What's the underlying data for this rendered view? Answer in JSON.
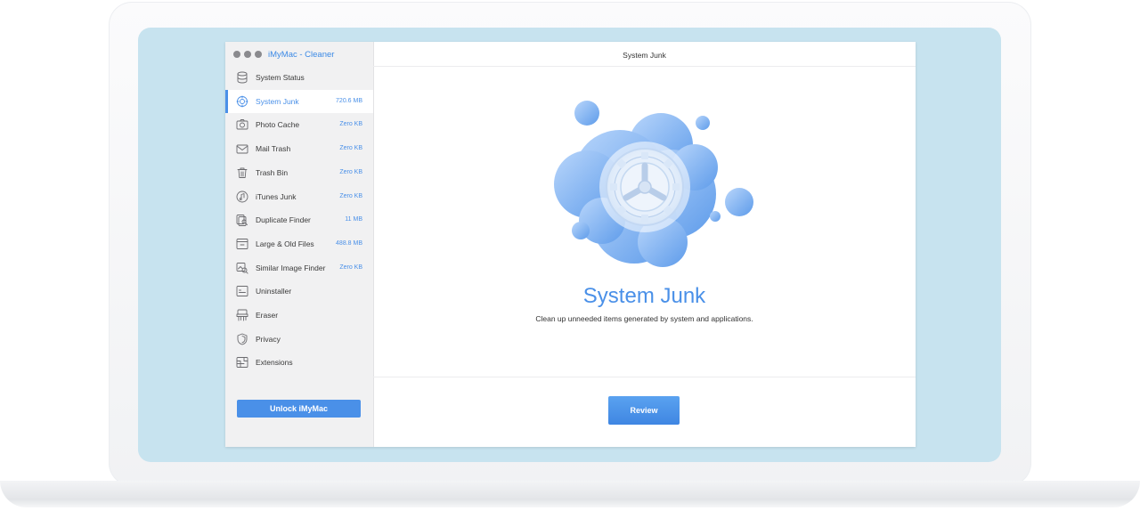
{
  "app": {
    "title": "iMyMac - Cleaner",
    "colors": {
      "accent": "#4a90e8",
      "bezel": "#c7e3ef",
      "sidebar_bg": "#f1f1f2"
    }
  },
  "sidebar": {
    "items": [
      {
        "label": "System Status",
        "size": "",
        "icon": "database-icon",
        "active": false
      },
      {
        "label": "System Junk",
        "size": "720.6 MB",
        "icon": "gear-icon",
        "active": true
      },
      {
        "label": "Photo Cache",
        "size": "Zero KB",
        "icon": "camera-icon",
        "active": false
      },
      {
        "label": "Mail Trash",
        "size": "Zero KB",
        "icon": "mail-icon",
        "active": false
      },
      {
        "label": "Trash Bin",
        "size": "Zero KB",
        "icon": "trash-icon",
        "active": false
      },
      {
        "label": "iTunes Junk",
        "size": "Zero KB",
        "icon": "music-icon",
        "active": false
      },
      {
        "label": "Duplicate Finder",
        "size": "11 MB",
        "icon": "duplicate-search-icon",
        "active": false
      },
      {
        "label": "Large & Old Files",
        "size": "488.8 MB",
        "icon": "file-box-icon",
        "active": false
      },
      {
        "label": "Similar Image Finder",
        "size": "Zero KB",
        "icon": "image-search-icon",
        "active": false
      },
      {
        "label": "Uninstaller",
        "size": "",
        "icon": "app-icon",
        "active": false
      },
      {
        "label": "Eraser",
        "size": "",
        "icon": "shredder-icon",
        "active": false
      },
      {
        "label": "Privacy",
        "size": "",
        "icon": "shield-icon",
        "active": false
      },
      {
        "label": "Extensions",
        "size": "",
        "icon": "extension-icon",
        "active": false
      }
    ],
    "unlock_label": "Unlock iMyMac"
  },
  "main": {
    "header_title": "System Junk",
    "hero_title": "System Junk",
    "hero_subtitle": "Clean up unneeded items generated by system and applications.",
    "review_label": "Review"
  }
}
